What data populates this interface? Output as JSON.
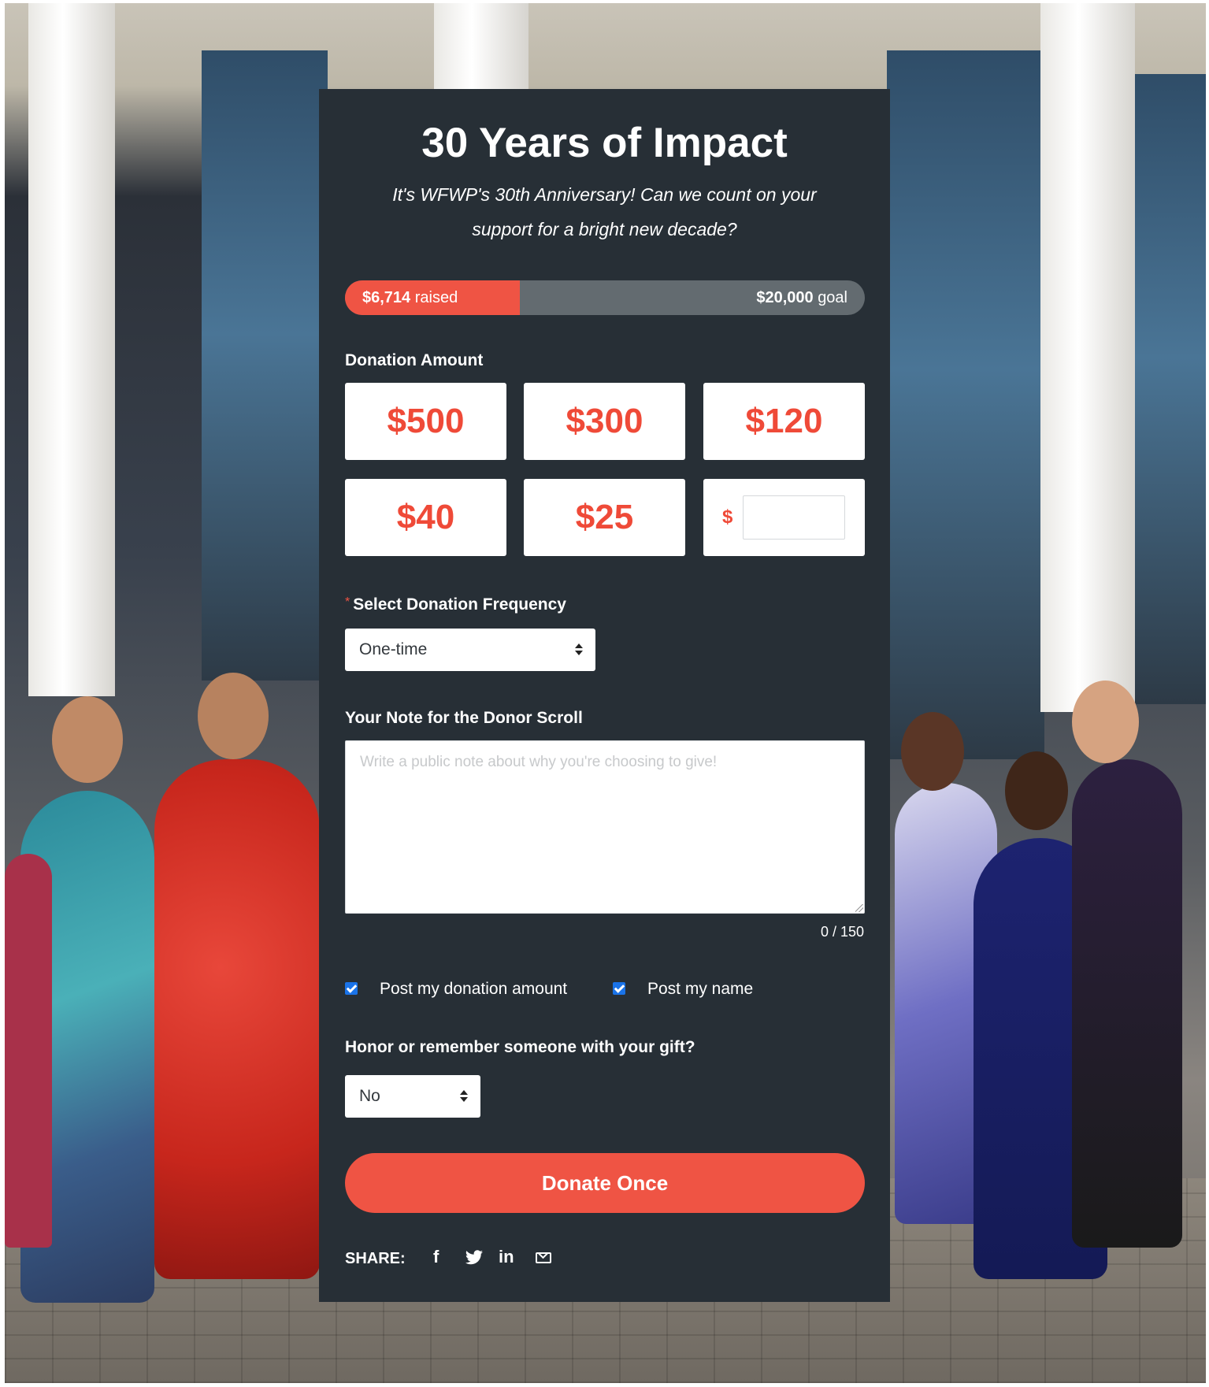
{
  "campaign": {
    "title": "30 Years of Impact",
    "subtitle": "It's WFWP's 30th Anniversary! Can we count on your support for a bright new decade?"
  },
  "progress": {
    "raised_amount": "$6,714",
    "raised_suffix": "raised",
    "goal_amount": "$20,000",
    "goal_suffix": "goal",
    "fraction": 0.3357
  },
  "donation": {
    "label": "Donation Amount",
    "amounts": [
      "$500",
      "$300",
      "$120",
      "$40",
      "$25"
    ],
    "custom_currency": "$",
    "custom_value": ""
  },
  "frequency": {
    "required_mark": "*",
    "label": "Select Donation Frequency",
    "selected": "One-time"
  },
  "note": {
    "label": "Your Note for the Donor Scroll",
    "placeholder": "Write a public note about why you're choosing to give!",
    "value": "",
    "counter": "0 / 150"
  },
  "options": {
    "post_amount_label": "Post my donation amount",
    "post_amount_checked": true,
    "post_name_label": "Post my name",
    "post_name_checked": true
  },
  "honor": {
    "label": "Honor or remember someone with your gift?",
    "selected": "No"
  },
  "submit": {
    "label": "Donate Once"
  },
  "share": {
    "label": "SHARE:",
    "icons": [
      "facebook-icon",
      "twitter-icon",
      "linkedin-icon",
      "email-icon"
    ]
  },
  "colors": {
    "accent": "#ef5444",
    "card_bg": "#272f36",
    "progress_track": "#636b70",
    "checkbox": "#1a73e8"
  }
}
